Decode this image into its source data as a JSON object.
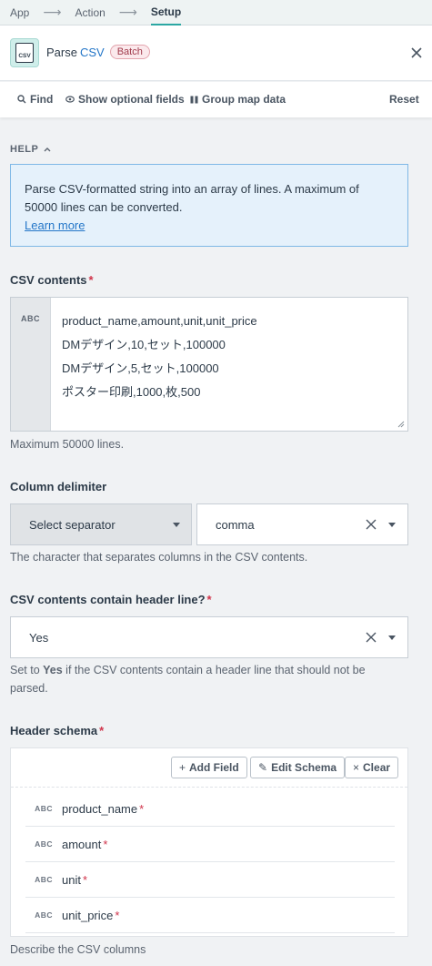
{
  "breadcrumb": {
    "items": [
      "App",
      "Action",
      "Setup"
    ]
  },
  "header": {
    "title": "Parse",
    "title_accent": "CSV",
    "badge": "Batch",
    "icon_label": "CSV"
  },
  "toolbar": {
    "find": "Find",
    "optional": "Show optional fields",
    "group": "Group map data",
    "reset": "Reset"
  },
  "help": {
    "label": "HELP",
    "text": "Parse CSV-formatted string into an array of lines. A maximum of 50000 lines can be converted.",
    "link": "Learn more"
  },
  "csv_contents": {
    "label": "CSV contents",
    "type_tag": "ABC",
    "value": "product_name,amount,unit,unit_price\nDMデザイン,10,セット,100000\nDMデザイン,5,セット,100000\nポスター印刷,1000,枚,500",
    "hint": "Maximum 50000 lines."
  },
  "column_delimiter": {
    "label": "Column delimiter",
    "mode": "Select separator",
    "value": "comma",
    "hint": "The character that separates columns in the CSV contents."
  },
  "header_line": {
    "label": "CSV contents contain header line?",
    "value": "Yes",
    "hint_pre": "Set to ",
    "hint_bold": "Yes",
    "hint_post": " if the CSV contents contain a header line that should not be parsed."
  },
  "header_schema": {
    "label": "Header schema",
    "buttons": {
      "add": "Add Field",
      "edit": "Edit Schema",
      "clear": "Clear"
    },
    "fields": [
      {
        "type": "ABC",
        "name": "product_name"
      },
      {
        "type": "ABC",
        "name": "amount"
      },
      {
        "type": "ABC",
        "name": "unit"
      },
      {
        "type": "ABC",
        "name": "unit_price"
      }
    ],
    "hint": "Describe the CSV columns"
  },
  "colors": {
    "accent": "#2ba7a3",
    "link": "#2476c8",
    "required": "#d0334a",
    "help_bg": "#e5f1fb"
  }
}
